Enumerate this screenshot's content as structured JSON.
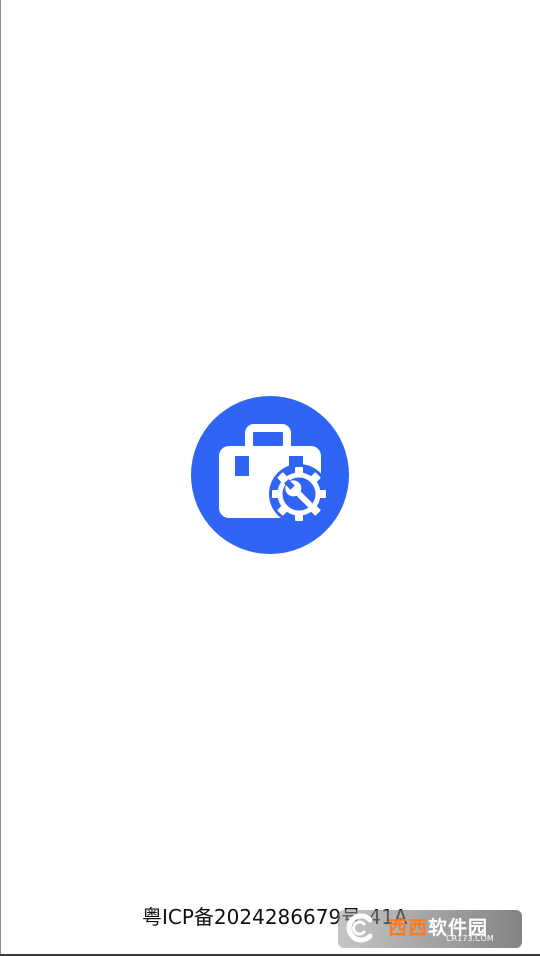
{
  "splash": {
    "logo_icon": "toolbox-gear-icon",
    "accent_color": "#2f64f4"
  },
  "footer": {
    "icp_text": "粤ICP备2024286679号-41A"
  },
  "watermark": {
    "brand_highlight": "西西",
    "brand_rest": "软件园",
    "url": "CR173.COM"
  }
}
